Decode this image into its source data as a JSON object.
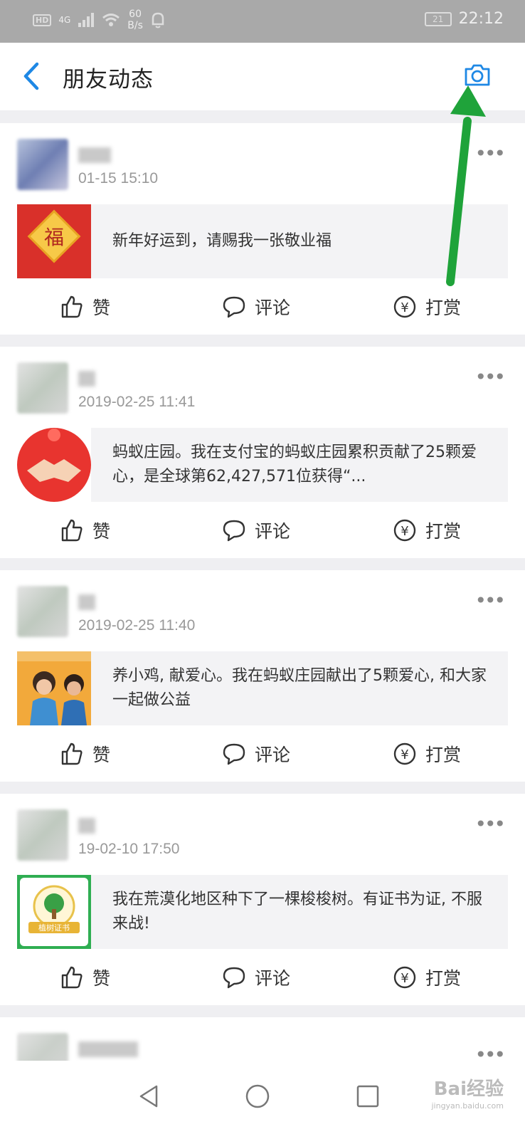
{
  "status_bar": {
    "hd": "HD",
    "network": "4G",
    "speed_value": "60",
    "speed_unit": "B/s",
    "battery": "21",
    "time": "22:12"
  },
  "nav": {
    "title": "朋友动态",
    "back_icon": "chevron-left-icon",
    "camera_icon": "camera-icon"
  },
  "accent_color": "#1e88e5",
  "annotation_arrow_color": "#1fa33a",
  "actions": {
    "like": "赞",
    "comment": "评论",
    "reward": "打赏"
  },
  "posts": [
    {
      "time": "01-15 15:10",
      "thumb": "fortune-fu-card",
      "text": "新年好运到，请赐我一张敬业福"
    },
    {
      "time": "2019-02-25 11:41",
      "thumb": "handshake-heart",
      "text": "蚂蚁庄园。我在支付宝的蚂蚁庄园累积贡献了25颗爱心，是全球第62,427,571位获得“..."
    },
    {
      "time": "2019-02-25 11:40",
      "thumb": "children-photo",
      "text": "养小鸡, 献爱心。我在蚂蚁庄园献出了5颗爱心, 和大家一起做公益"
    },
    {
      "time": "19-02-10 17:50",
      "thumb": "tree-certificate",
      "thumb_label": "植树证书",
      "text": "我在荒漠化地区种下了一棵梭梭树。有证书为证, 不服来战!"
    }
  ],
  "watermark": {
    "brand": "Bai经验",
    "url": "jingyan.baidu.com"
  }
}
